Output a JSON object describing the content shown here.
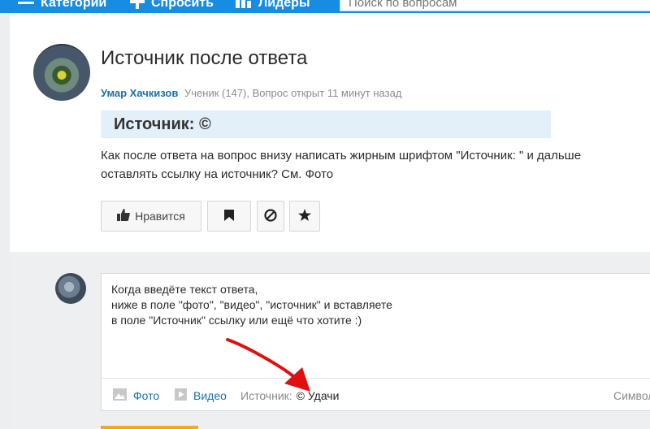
{
  "nav": {
    "categories_label": "Категории",
    "ask_label": "Спросить",
    "leaders_label": "Лидеры",
    "search_placeholder": "Поиск по вопросам"
  },
  "question": {
    "title": "Источник после ответа",
    "author": "Умар Хачкизов",
    "meta": "Ученик (147), Вопрос открыт 11 минут назад",
    "source_banner": "Источник: ©",
    "body_lines": [
      "Как после ответа на вопрос внизу написать жирным шрифтом \"Источник: \" и дальше",
      "оставлять ссылку на источник? См. Фото"
    ],
    "like_label": "Нравится"
  },
  "answer": {
    "lines": [
      "Когда введёте текст ответа,",
      "ниже в поле \"фото\", \"видео\", \"источник\" и вставляете",
      "в поле \"Источник\" ссылку или ещё что хотите :)"
    ],
    "photo_label": "Фото",
    "video_label": "Видео",
    "source_label": "Источник:",
    "source_value": "© Удачи",
    "chars_label": "Символ"
  },
  "icons": {
    "menu": "menu-icon",
    "plus": "plus-icon",
    "leaders": "bar-chart-icon",
    "like": "thumbs-up-icon",
    "flag": "flag-icon",
    "block": "block-icon",
    "star": "star-icon",
    "photo": "photo-icon",
    "video": "play-icon"
  },
  "colors": {
    "nav_blue": "#168de2",
    "link_blue": "#1a6fb0",
    "source_banner_bg": "#e3f0fa",
    "annotation_red": "#e01010",
    "answer_bg": "#eeeff1"
  }
}
